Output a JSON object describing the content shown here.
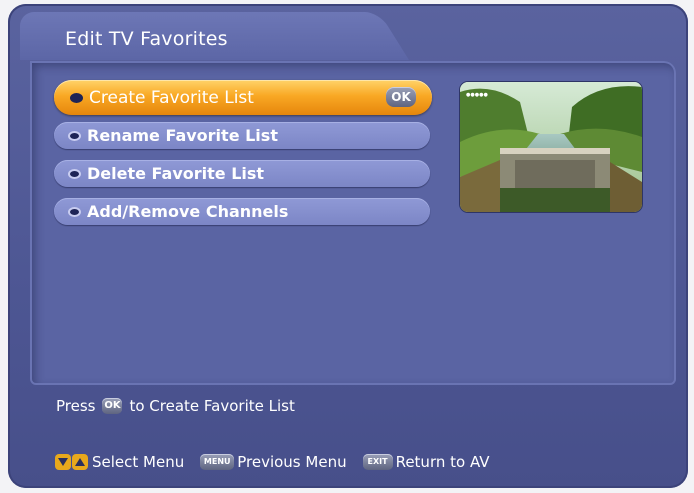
{
  "header": {
    "title": "Edit TV Favorites"
  },
  "menu": {
    "items": [
      {
        "label": "Create Favorite List",
        "selected": true
      },
      {
        "label": "Rename Favorite List",
        "selected": false
      },
      {
        "label": "Delete Favorite List",
        "selected": false
      },
      {
        "label": "Add/Remove Channels",
        "selected": false
      }
    ],
    "ok_badge": "OK"
  },
  "hint": {
    "prefix": "Press",
    "key": "OK",
    "suffix": "to Create Favorite List"
  },
  "footer": {
    "select_label": "Select Menu",
    "menu_key": "MENU",
    "previous_label": "Previous Menu",
    "exit_key": "EXIT",
    "return_label": "Return to AV"
  },
  "colors": {
    "selected_start": "#ffd36a",
    "selected_end": "#e6860c",
    "panel": "#5a64a3",
    "item": "#8f99d6"
  }
}
